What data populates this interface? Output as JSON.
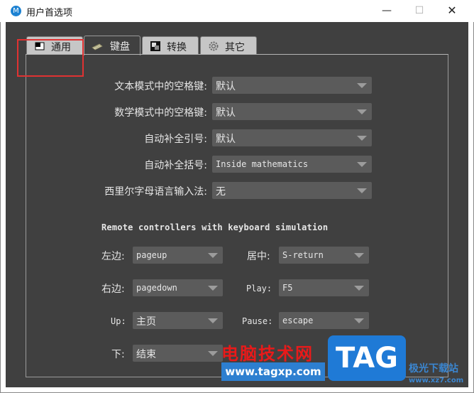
{
  "window": {
    "title": "用户首选项",
    "app_icon_glyph": "M",
    "minimize_glyph": "—",
    "maximize_glyph": "☐",
    "close_glyph": "✕"
  },
  "tabs": [
    {
      "label": "通用",
      "icon": "general-icon"
    },
    {
      "label": "键盘",
      "icon": "keyboard-icon",
      "active": true
    },
    {
      "label": "转换",
      "icon": "convert-icon"
    },
    {
      "label": "其它",
      "icon": "gear-icon"
    }
  ],
  "keyboard": {
    "rows": [
      {
        "label": "文本模式中的空格键:",
        "value": "默认"
      },
      {
        "label": "数学模式中的空格键:",
        "value": "默认"
      },
      {
        "label": "自动补全引号:",
        "value": "默认"
      },
      {
        "label": "自动补全括号:",
        "value": "Inside mathematics"
      },
      {
        "label": "西里尔字母语言输入法:",
        "value": "无"
      }
    ],
    "section_title": "Remote controllers with keyboard simulation",
    "remote": {
      "left_label": "左边:",
      "left_value": "pageup",
      "center_label": "居中:",
      "center_value": "S-return",
      "right_label": "右边:",
      "right_value": "pagedown",
      "play_label": "Play:",
      "play_value": "F5",
      "up_label": "Up:",
      "up_value": "主页",
      "pause_label": "Pause:",
      "pause_value": "escape",
      "down_label": "下:",
      "down_value": "结束"
    }
  },
  "watermark": {
    "text": "电脑技术网",
    "url": "www.tagxp.com",
    "tag": "TAG",
    "site": "极光下载站",
    "site_url": "www.xz7.com"
  },
  "colors": {
    "dialog_bg": "#404040",
    "field_bg": "#5b5b5b",
    "highlight": "#e03232",
    "accent": "#1d82d2"
  }
}
